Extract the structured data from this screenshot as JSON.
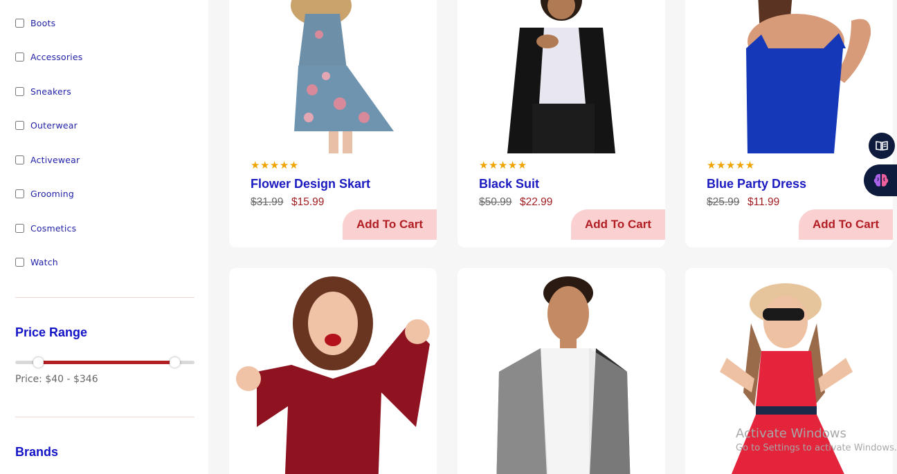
{
  "sidebar": {
    "categories": [
      "Boots",
      "Accessories",
      "Sneakers",
      "Outerwear",
      "Activewear",
      "Grooming",
      "Cosmetics",
      "Watch"
    ],
    "price_range": {
      "title": "Price Range",
      "label": "Price: $40 - $346",
      "low_fraction": 0.13,
      "high_fraction": 0.89
    },
    "brands_title": "Brands"
  },
  "products": [
    {
      "name": "Flower Design Skart",
      "old_price": "$31.99",
      "new_price": "$15.99",
      "stars": "★★★★★",
      "button": "Add To Cart"
    },
    {
      "name": "Black Suit",
      "old_price": "$50.99",
      "new_price": "$22.99",
      "stars": "★★★★★",
      "button": "Add To Cart"
    },
    {
      "name": "Blue Party Dress",
      "old_price": "$25.99",
      "new_price": "$11.99",
      "stars": "★★★★★",
      "button": "Add To Cart"
    }
  ],
  "floating": {
    "reader_icon": "book-open-icon",
    "ai_icon": "brain-icon"
  },
  "watermark": {
    "title": "Activate Windows",
    "subtitle": "Go to Settings to activate Windows."
  },
  "colors": {
    "accent_blue": "#1a1ac0",
    "price_red": "#a11d21",
    "cart_pink": "#fbd0d0",
    "star": "#f0a400",
    "slider": "#b41f24"
  }
}
